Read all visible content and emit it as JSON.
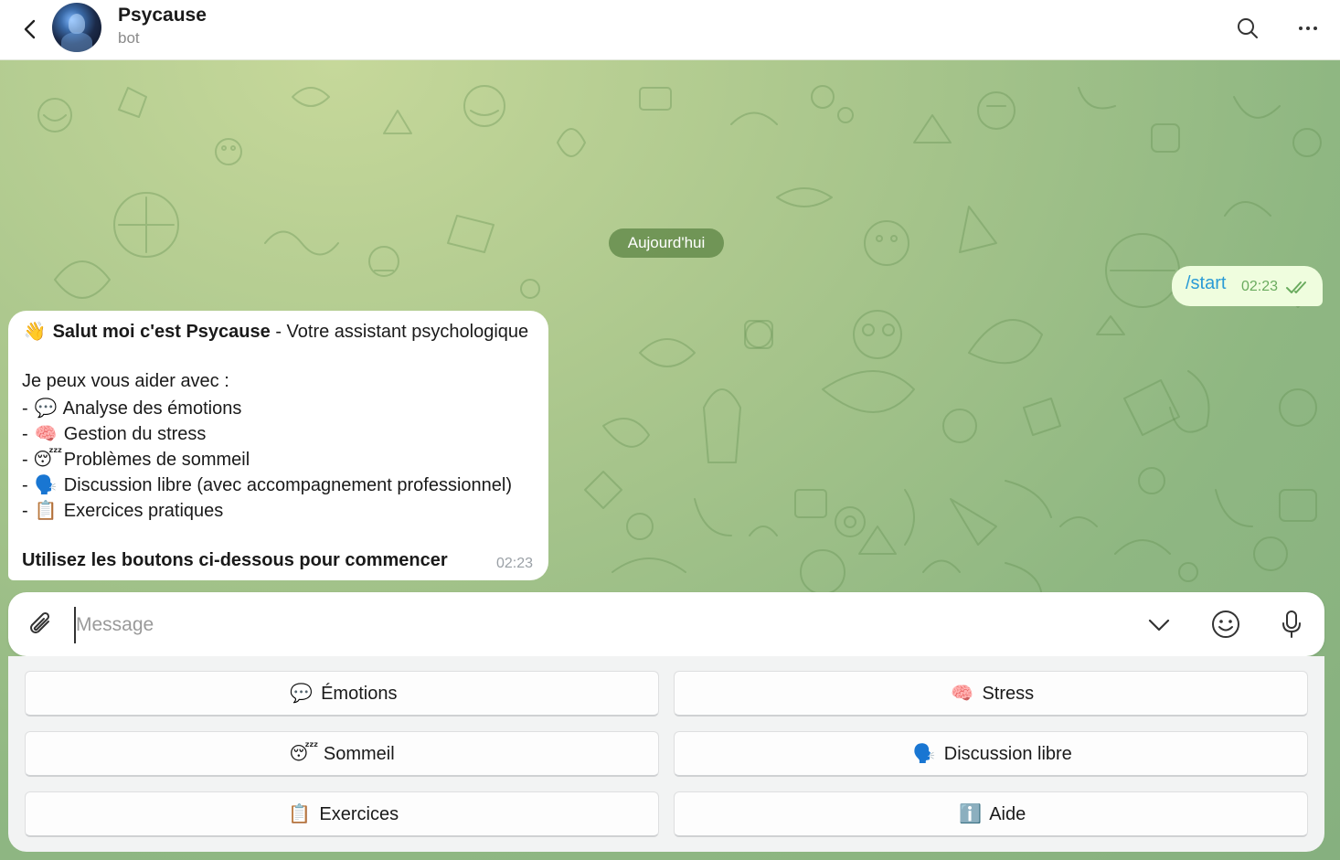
{
  "header": {
    "title": "Psycause",
    "subtitle": "bot"
  },
  "date_separator": "Aujourd'hui",
  "outgoing": {
    "text": "/start",
    "time": "02:23"
  },
  "incoming": {
    "line1_emoji": "👋",
    "line1_bold": "Salut moi c'est Psycause",
    "line1_rest": " - Votre assistant psychologique",
    "intro": "Je peux vous aider avec :",
    "items": [
      {
        "prefix": "- ",
        "emoji": "💬",
        "text": "Analyse des émotions"
      },
      {
        "prefix": "- ",
        "emoji": "🧠",
        "text": "Gestion du stress"
      },
      {
        "prefix": "- ",
        "emoji": "😴",
        "text": "Problèmes de sommeil"
      },
      {
        "prefix": "- ",
        "emoji": "🗣️",
        "text": "Discussion libre (avec accompagnement professionnel)"
      },
      {
        "prefix": "- ",
        "emoji": "📋",
        "text": "Exercices pratiques"
      }
    ],
    "footer": "Utilisez les boutons ci-dessous pour commencer",
    "time": "02:23"
  },
  "composer": {
    "placeholder": "Message"
  },
  "keyboard": {
    "buttons": [
      {
        "emoji": "💬",
        "label": "Émotions"
      },
      {
        "emoji": "🧠",
        "label": "Stress"
      },
      {
        "emoji": "😴",
        "label": "Sommeil"
      },
      {
        "emoji": "🗣️",
        "label": "Discussion libre"
      },
      {
        "emoji": "📋",
        "label": "Exercices"
      },
      {
        "emoji": "ℹ️",
        "label": "Aide"
      }
    ]
  },
  "colors": {
    "outgoing_bubble": "#effdde",
    "link_blue": "#2a9bd6",
    "date_pill": "#5f8746",
    "check_green": "#6aab5e"
  }
}
